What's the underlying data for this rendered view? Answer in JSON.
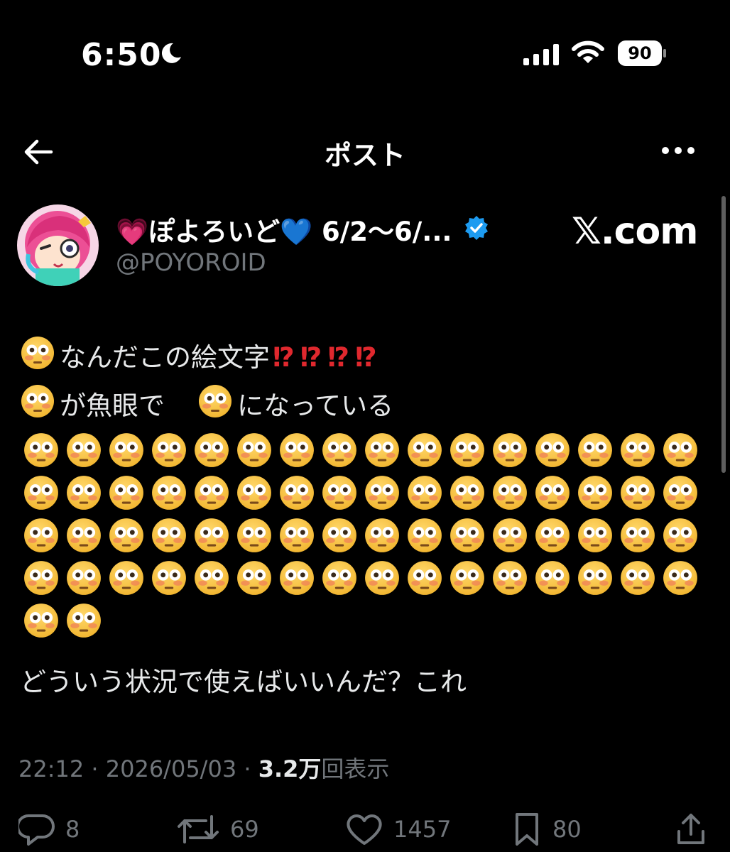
{
  "status_bar": {
    "time": "6:50",
    "battery": "90"
  },
  "header": {
    "title": "ポスト"
  },
  "author": {
    "name_prefix": "💗",
    "name": "ぽよろいど",
    "name_suffix": "💙",
    "name_trail": " 6/2～6/...",
    "handle": "@POYOROID",
    "watermark": "𝕏.com"
  },
  "body": {
    "line1": {
      "text": "なんだこの絵文字",
      "marks": [
        "⁉",
        "⁉",
        "⁉",
        "⁉"
      ]
    },
    "line2": {
      "a": "が魚眼で",
      "b": "になっている"
    },
    "emoji_rows": [
      16,
      16,
      16,
      16,
      2
    ],
    "line_last": "どういう状況で使えばいいんだ？これ"
  },
  "meta": {
    "time": "22:12",
    "date": "2026/05/03",
    "views_num": "3.2万",
    "views_label": "回表示",
    "sep": " · "
  },
  "actions": {
    "replies": "8",
    "reposts": "69",
    "likes": "1457",
    "bookmarks": "80"
  },
  "colors": {
    "accent": "#1d9bf0",
    "muted": "#71767b",
    "emoji_face": "#f2b631",
    "exclaim": "#e0282e"
  }
}
